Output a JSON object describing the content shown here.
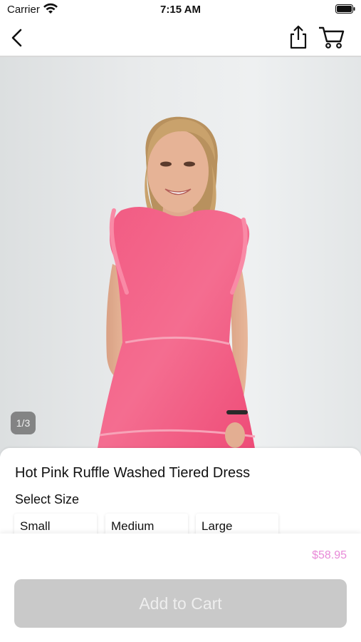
{
  "status_bar": {
    "carrier": "Carrier",
    "time": "7:15 AM"
  },
  "nav": {
    "back_icon": "chevron-left-icon",
    "share_icon": "share-icon",
    "cart_icon": "cart-icon"
  },
  "gallery": {
    "page_indicator": "1/3"
  },
  "product": {
    "title": "Hot Pink Ruffle Washed Tiered Dress",
    "select_size_label": "Select Size",
    "sizes": [
      "Small",
      "Medium",
      "Large"
    ],
    "price": "$58.95",
    "add_to_cart_label": "Add to Cart"
  },
  "colors": {
    "price": "#e88ad8",
    "button_disabled": "#c9c9c9",
    "dress": "#f4587f"
  }
}
